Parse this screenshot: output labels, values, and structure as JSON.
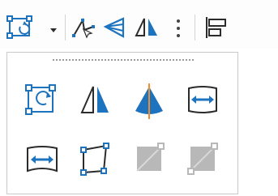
{
  "colors": {
    "accent": "#1e73be",
    "icon_dark": "#2b2b2b",
    "disabled": "#b8b8b8",
    "flip_orange": "#f28c28",
    "panel_border": "#c9c9c9",
    "grip": "#9a9a9a"
  },
  "toolbar": {
    "items": [
      {
        "name": "transform-tool",
        "icon": "rotate-frame-icon"
      },
      {
        "name": "transform-dropdown",
        "icon": "caret-down-icon"
      },
      {
        "name": "vertex-tool",
        "icon": "node-edit-icon"
      },
      {
        "name": "perspective-tool",
        "icon": "perspective-icon"
      },
      {
        "name": "mirror-tool",
        "icon": "mirror-icon"
      },
      {
        "name": "more-options",
        "icon": "kebab-icon"
      },
      {
        "name": "align-tool",
        "icon": "align-left-icon"
      }
    ]
  },
  "panel": {
    "grip_icon": "drag-grip-icon",
    "tools": [
      {
        "name": "rotate",
        "icon": "rotate-frame-icon",
        "enabled": true
      },
      {
        "name": "mirror",
        "icon": "mirror-icon",
        "enabled": true
      },
      {
        "name": "flip",
        "icon": "flip-cone-icon",
        "enabled": true
      },
      {
        "name": "scale-horizontal",
        "icon": "stretch-horizontal-icon",
        "enabled": true
      },
      {
        "name": "warp",
        "icon": "warp-icon",
        "enabled": true
      },
      {
        "name": "distort",
        "icon": "distort-icon",
        "enabled": true
      },
      {
        "name": "shear",
        "icon": "shear-icon",
        "enabled": false
      },
      {
        "name": "skew",
        "icon": "skew-icon",
        "enabled": false
      }
    ]
  }
}
